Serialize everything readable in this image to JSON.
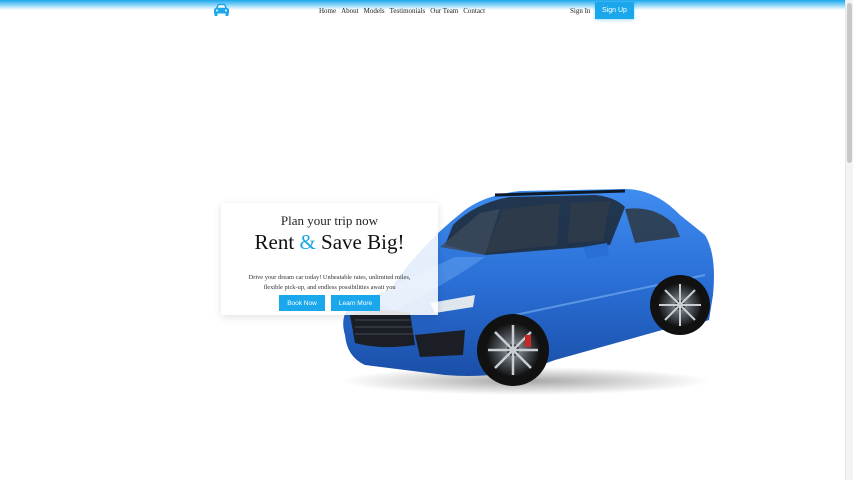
{
  "nav": {
    "logo_icon": "car-icon",
    "links": [
      "Home",
      "About",
      "Models",
      "Testimonials",
      "Our Team",
      "Contact"
    ],
    "signin_label": "Sign In",
    "signup_label": "Sign Up"
  },
  "hero": {
    "subtitle": "Plan your trip now",
    "title_part1": "Rent",
    "title_amp": "&",
    "title_part2": "Save Big!",
    "description": "Drive your dream car today! Unbeatable rates, unlimited miles, flexible pick-up, and endless possibilities await you",
    "book_label": "Book Now",
    "learn_label": "Learn More"
  },
  "colors": {
    "accent": "#1aa7ec",
    "car_body": "#2a6fd6"
  }
}
